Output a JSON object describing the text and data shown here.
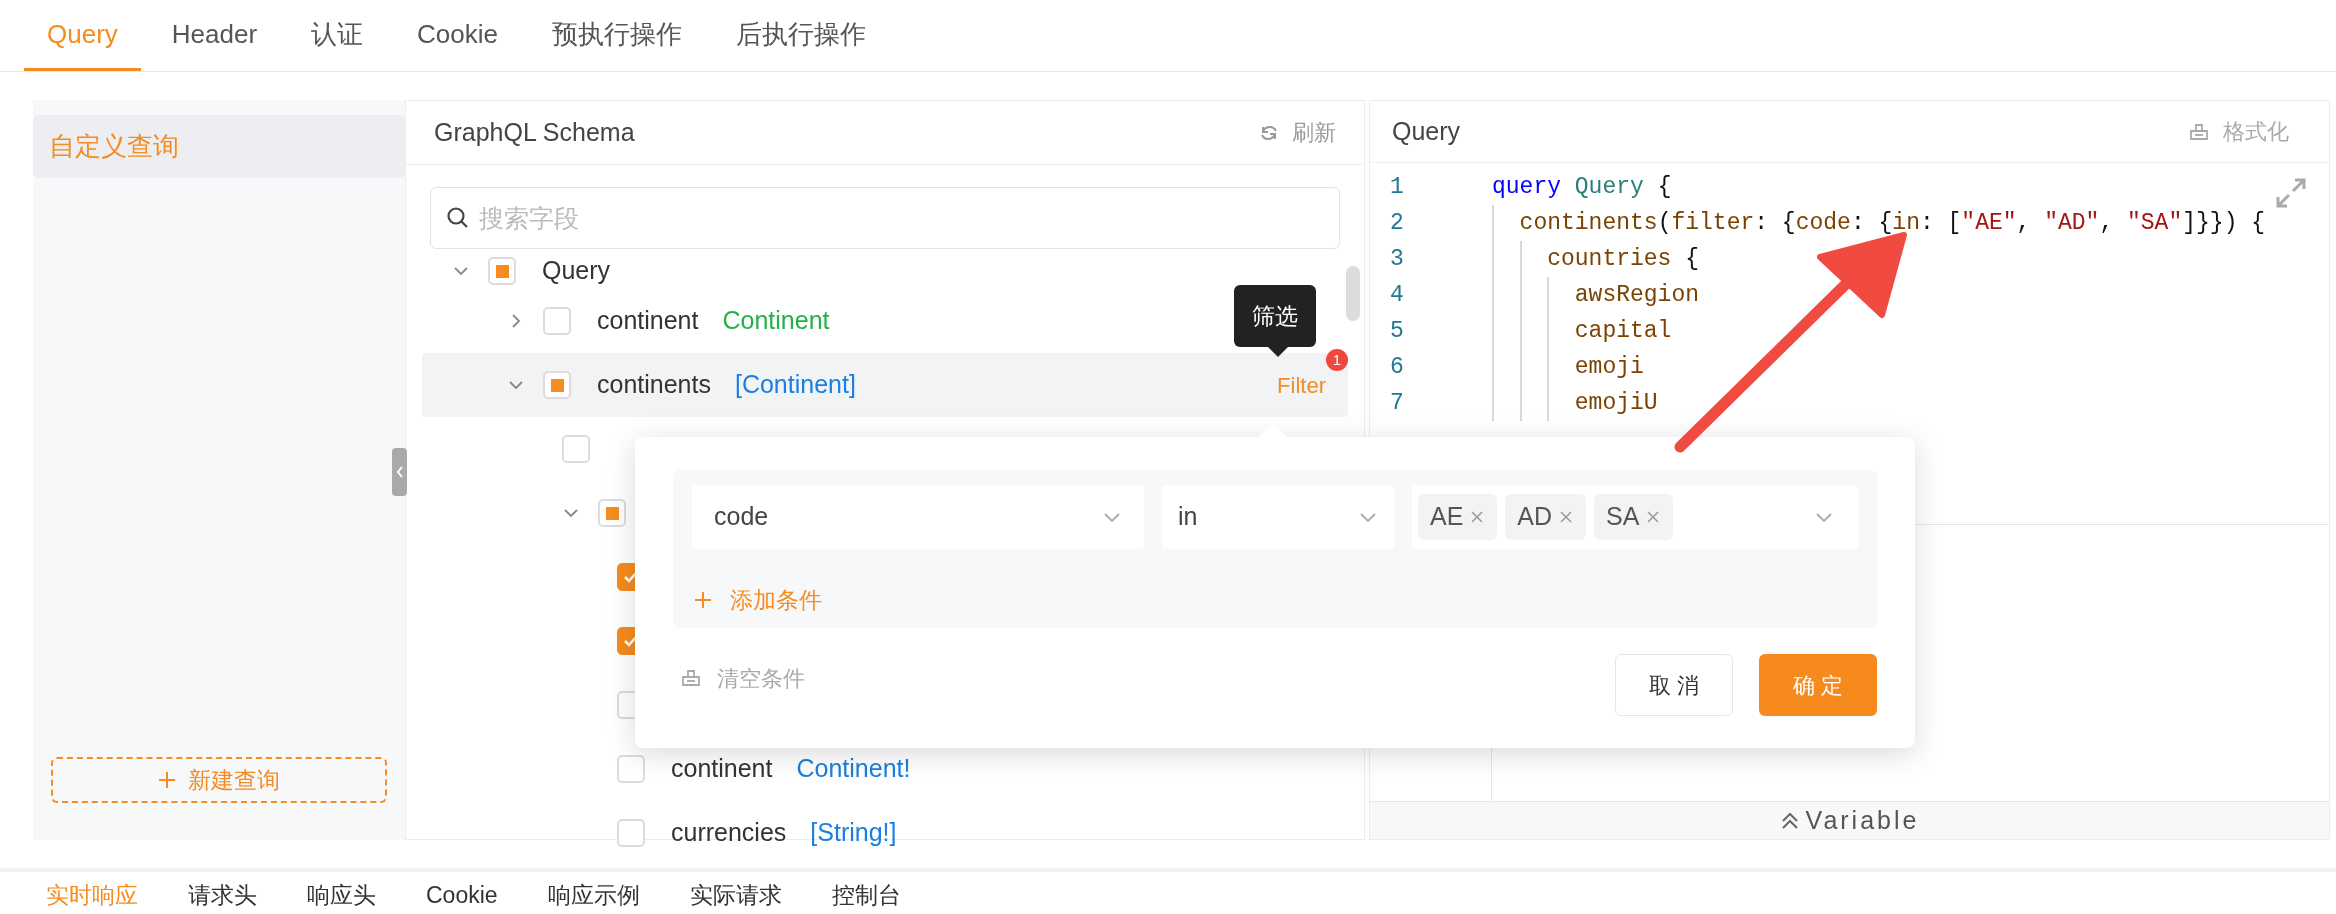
{
  "tabs": [
    {
      "label": "Query",
      "selected": true
    },
    {
      "label": "Header",
      "selected": false
    },
    {
      "label": "认证",
      "selected": false
    },
    {
      "label": "Cookie",
      "selected": false
    },
    {
      "label": "预执行操作",
      "selected": false
    },
    {
      "label": "后执行操作",
      "selected": false
    }
  ],
  "sidebar": {
    "items": [
      {
        "label": "自定义查询",
        "selected": true
      }
    ],
    "new_button": "新建查询"
  },
  "schema_panel": {
    "title": "GraphQL Schema",
    "refresh_button": "刷新",
    "search": {
      "placeholder": "搜索字段"
    },
    "tree": [
      {
        "kind": "branch",
        "name": "Query",
        "expanded": true,
        "checked": false,
        "indeterminate": true,
        "highlighted": false,
        "children": [
          {
            "kind": "branch",
            "name": "continent",
            "type": "Continent",
            "color": "#22b14c",
            "expanded": false,
            "checked": false,
            "indeterminate": false,
            "highlighted": false
          },
          {
            "kind": "branch",
            "name": "continents",
            "type": "[Continent]",
            "color": "#1a7fe0",
            "expanded": true,
            "checked": false,
            "indeterminate": true,
            "highlighted": true,
            "filter": {
              "label": "Filter",
              "badge": "1",
              "tooltip": "筛选"
            },
            "children": [
              {
                "kind": "leaf",
                "checked": false,
                "indeterminate": false,
                "highlighted": false
              },
              {
                "kind": "branch",
                "expanded": true,
                "checked": false,
                "indeterminate": true,
                "highlighted": false,
                "children": [
                  {
                    "kind": "leaf",
                    "checked": true,
                    "indeterminate": false,
                    "highlighted": false
                  },
                  {
                    "kind": "leaf",
                    "checked": true,
                    "indeterminate": false,
                    "highlighted": false
                  },
                  {
                    "kind": "leaf",
                    "checked": false,
                    "indeterminate": false,
                    "highlighted": false
                  },
                  {
                    "kind": "leaf",
                    "name": "continent",
                    "type": "Continent!",
                    "color": "#1a7fe0",
                    "checked": false,
                    "indeterminate": false,
                    "highlighted": false
                  },
                  {
                    "kind": "leaf",
                    "name": "currencies",
                    "type": "[String!]",
                    "color": "#1a7fe0",
                    "checked": false,
                    "indeterminate": false,
                    "highlighted": false
                  }
                ]
              }
            ]
          }
        ]
      }
    ]
  },
  "query_panel": {
    "title": "Query",
    "format_button": "格式化",
    "lines": [
      {
        "number": "1",
        "tokens": [
          {
            "kind": "keyword",
            "text": "query"
          },
          {
            "kind": "type",
            "text": " Query"
          },
          {
            "kind": "punct",
            "text": " {"
          }
        ]
      },
      {
        "number": "2",
        "tokens": [
          {
            "kind": "field",
            "text": "  continents"
          },
          {
            "kind": "punct",
            "text": "("
          },
          {
            "kind": "field",
            "text": "filter"
          },
          {
            "kind": "punct",
            "text": ": {"
          },
          {
            "kind": "field",
            "text": "code"
          },
          {
            "kind": "punct",
            "text": ": {"
          },
          {
            "kind": "field",
            "text": "in"
          },
          {
            "kind": "punct",
            "text": ": ["
          },
          {
            "kind": "string",
            "text": "\"AE\""
          },
          {
            "kind": "punct",
            "text": ", "
          },
          {
            "kind": "string",
            "text": "\"AD\""
          },
          {
            "kind": "punct",
            "text": ", "
          },
          {
            "kind": "string",
            "text": "\"SA\""
          },
          {
            "kind": "punct",
            "text": "]}}) {"
          }
        ]
      },
      {
        "number": "3",
        "tokens": [
          {
            "kind": "field",
            "text": "    countries"
          },
          {
            "kind": "punct",
            "text": " {"
          }
        ]
      },
      {
        "number": "4",
        "tokens": [
          {
            "kind": "field",
            "text": "      awsRegion"
          }
        ]
      },
      {
        "number": "5",
        "tokens": [
          {
            "kind": "field",
            "text": "      capital"
          }
        ]
      },
      {
        "number": "6",
        "tokens": [
          {
            "kind": "field",
            "text": "      emoji"
          }
        ]
      },
      {
        "number": "7",
        "tokens": [
          {
            "kind": "field",
            "text": "      emojiU"
          }
        ]
      }
    ],
    "variable_bar": "Variable"
  },
  "filter_popup": {
    "conditions": [
      {
        "field": "code",
        "operator": "in",
        "values": [
          "AE",
          "AD",
          "SA"
        ]
      }
    ],
    "add_button": "添加条件",
    "clear_button": "清空条件",
    "cancel_button": "取 消",
    "ok_button": "确 定"
  },
  "bottom_tabs": [
    {
      "label": "实时响应",
      "selected": true
    },
    {
      "label": "请求头",
      "selected": false
    },
    {
      "label": "响应头",
      "selected": false
    },
    {
      "label": "Cookie",
      "selected": false
    },
    {
      "label": "响应示例",
      "selected": false
    },
    {
      "label": "实际请求",
      "selected": false
    },
    {
      "label": "控制台",
      "selected": false
    }
  ]
}
